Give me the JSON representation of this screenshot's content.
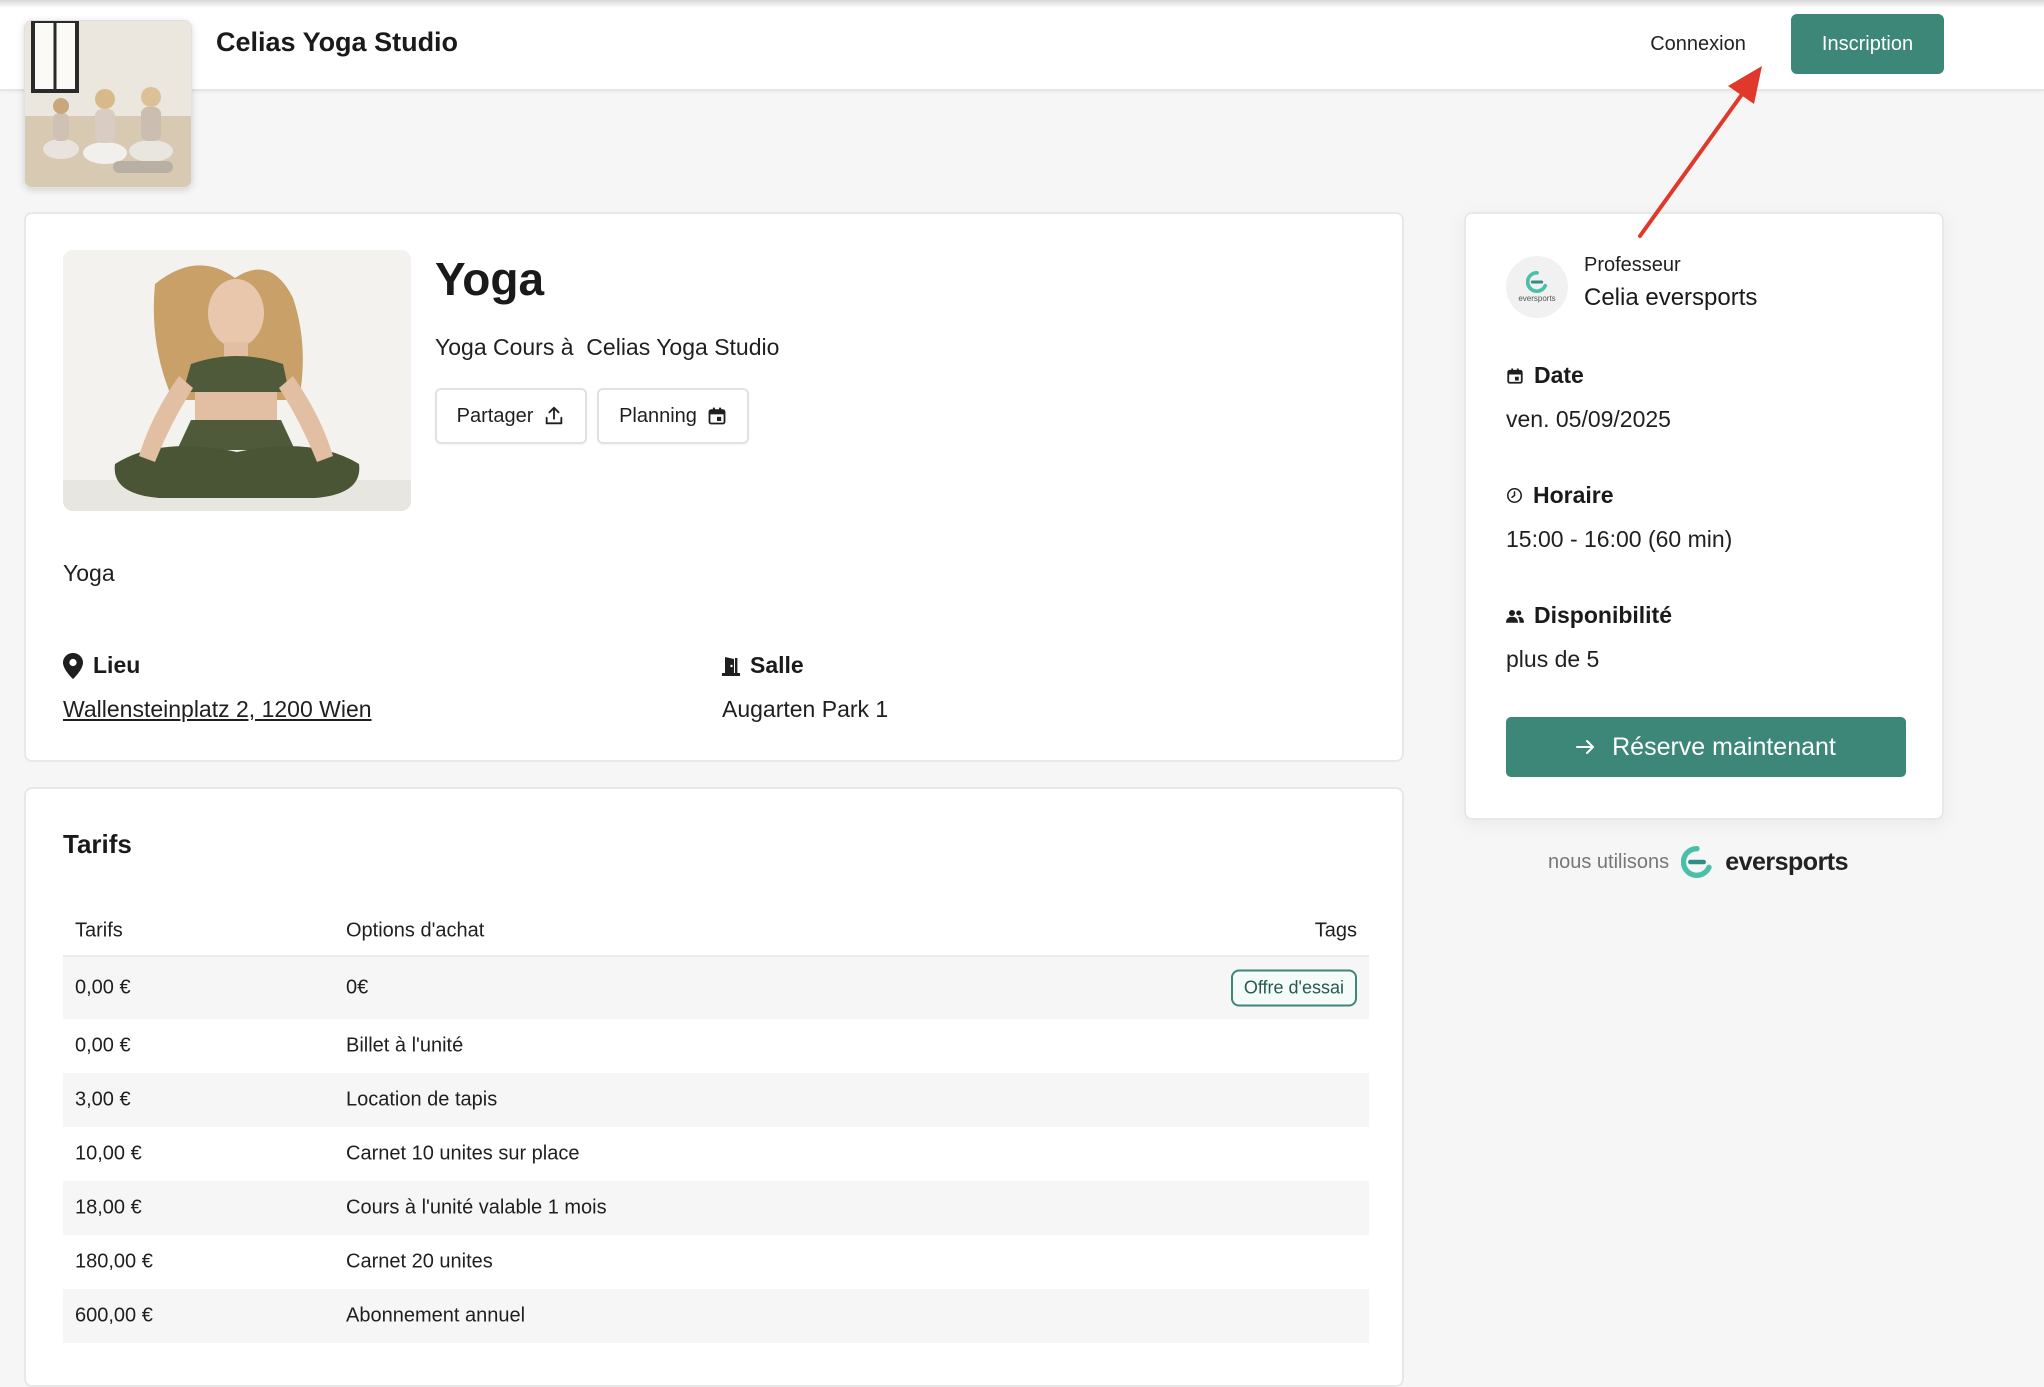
{
  "colors": {
    "accent": "#3d8778",
    "annotation_arrow": "#e0392b"
  },
  "header": {
    "studio_name": "Celias Yoga Studio",
    "login_label": "Connexion",
    "signup_label": "Inscription"
  },
  "course": {
    "title": "Yoga",
    "subtitle": "Yoga Cours à  Celias Yoga Studio",
    "share_label": "Partager",
    "planning_label": "Planning",
    "description": "Yoga",
    "location_label": "Lieu",
    "location_value": "Wallensteinplatz 2, 1200 Wien",
    "room_label": "Salle",
    "room_value": "Augarten Park 1"
  },
  "tarifs": {
    "title": "Tarifs",
    "columns": [
      "Tarifs",
      "Options d'achat",
      "Tags"
    ],
    "rows": [
      {
        "price": "0,00 €",
        "option": "0€",
        "tag": "Offre d'essai"
      },
      {
        "price": "0,00 €",
        "option": "Billet à l'unité",
        "tag": ""
      },
      {
        "price": "3,00 €",
        "option": "Location de tapis",
        "tag": ""
      },
      {
        "price": "10,00 €",
        "option": "Carnet 10 unites sur place",
        "tag": ""
      },
      {
        "price": "18,00 €",
        "option": "Cours à l'unité valable 1 mois",
        "tag": ""
      },
      {
        "price": "180,00 €",
        "option": "Carnet 20 unites",
        "tag": ""
      },
      {
        "price": "600,00 €",
        "option": "Abonnement annuel",
        "tag": ""
      }
    ]
  },
  "sidebar": {
    "teacher_role": "Professeur",
    "teacher_name": "Celia eversports",
    "avatar_text": "eversports",
    "date_label": "Date",
    "date_value": "ven. 05/09/2025",
    "time_label": "Horaire",
    "time_value": "15:00 - 16:00 (60 min)",
    "availability_label": "Disponibilité",
    "availability_value": "plus de 5",
    "book_label": "Réserve maintenant",
    "powered_text": "nous utilisons",
    "powered_brand": "eversports"
  },
  "icons": {
    "share": "upload-icon",
    "planning": "calendar-icon",
    "location": "map-pin-icon",
    "room": "door-icon",
    "date": "calendar-icon",
    "time": "clock-icon",
    "availability": "people-icon",
    "book": "arrow-right-icon",
    "brand": "eversports-logo-icon"
  }
}
